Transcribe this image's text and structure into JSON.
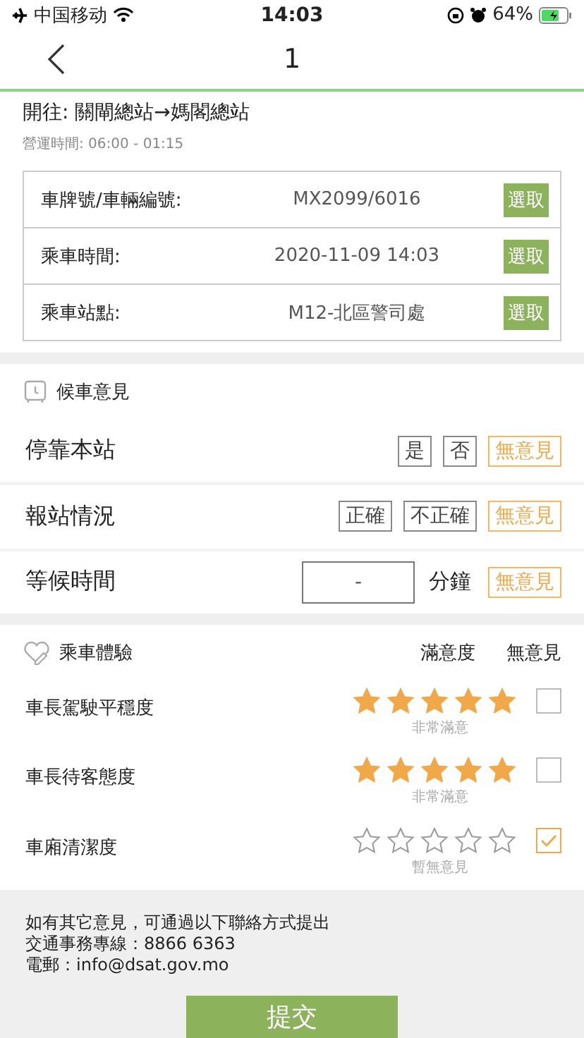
{
  "status_bar": {
    "carrier": "中国移动",
    "time": "14:03",
    "battery": "64%"
  },
  "nav": {
    "title": "1"
  },
  "route": {
    "direction": "開往: 關閘總站→媽閣總站",
    "hours": "營運時間: 06:00 - 01:15"
  },
  "trip_fields": [
    {
      "label": "車牌號/車輛編號:",
      "value": "MX2099/6016",
      "button": "選取"
    },
    {
      "label": "乘車時間:",
      "value": "2020-11-09 14:03",
      "button": "選取"
    },
    {
      "label": "乘車站點:",
      "value": "M12-北區警司處",
      "button": "選取"
    }
  ],
  "waiting_section": {
    "title": "候車意見",
    "questions": [
      {
        "kind": "choice",
        "label": "停靠本站",
        "options": [
          {
            "label": "是",
            "selected": false
          },
          {
            "label": "否",
            "selected": false
          },
          {
            "label": "無意見",
            "selected": true
          }
        ]
      },
      {
        "kind": "choice",
        "label": "報站情況",
        "options": [
          {
            "label": "正確",
            "selected": false
          },
          {
            "label": "不正確",
            "selected": false
          },
          {
            "label": "無意見",
            "selected": true
          }
        ]
      },
      {
        "kind": "duration",
        "label": "等候時間",
        "value": "-",
        "unit": "分鐘",
        "options": [
          {
            "label": "無意見",
            "selected": true
          }
        ]
      }
    ]
  },
  "experience_section": {
    "title": "乘車體驗",
    "column_headers": [
      "滿意度",
      "無意見"
    ],
    "ratings": [
      {
        "label": "車長駕駛平穩度",
        "stars": 5,
        "caption": "非常滿意",
        "no_opinion": false
      },
      {
        "label": "車長待客態度",
        "stars": 5,
        "caption": "非常滿意",
        "no_opinion": false
      },
      {
        "label": "車廂清潔度",
        "stars": 0,
        "caption": "暫無意見",
        "no_opinion": true
      }
    ]
  },
  "footer": {
    "lines": [
      "如有其它意見，可通過以下聯絡方式提出",
      "交通事務專線：8866 6363",
      "電郵：info@dsat.gov.mo"
    ],
    "submit": "提交"
  }
}
